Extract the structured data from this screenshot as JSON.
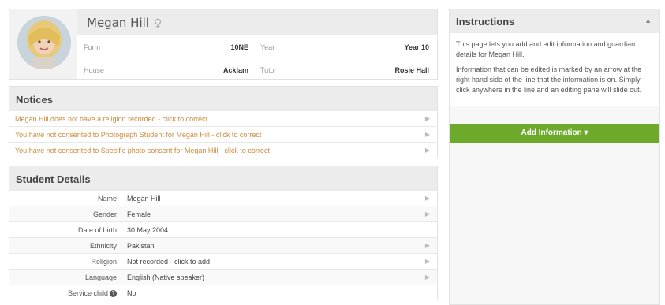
{
  "student": {
    "name": "Megan Hill",
    "gender_icon": "female-symbol-icon",
    "form_label": "Form",
    "form_value": "10NE",
    "year_label": "Year",
    "year_value": "Year 10",
    "house_label": "House",
    "house_value": "Acklam",
    "tutor_label": "Tutor",
    "tutor_value": "Rosie Hall"
  },
  "notices": {
    "title": "Notices",
    "items": [
      "Megan Hill does not have a religion recorded - click to correct",
      "You have not consented to Photograph Student for Megan Hill - click to correct",
      "You have not consented to Specific photo consent for Megan Hill - click to correct"
    ]
  },
  "details": {
    "title": "Student Details",
    "rows": [
      {
        "label": "Name",
        "value": "Megan Hill"
      },
      {
        "label": "Gender",
        "value": "Female"
      },
      {
        "label": "Date of birth",
        "value": "30 May 2004"
      },
      {
        "label": "Ethnicity",
        "value": "Pakistani"
      },
      {
        "label": "Religion",
        "value": "Not recorded - click to add"
      },
      {
        "label": "Language",
        "value": "English (Native speaker)"
      },
      {
        "label": "Service child",
        "value": "No"
      }
    ]
  },
  "instructions": {
    "title": "Instructions",
    "para1": "This page lets you add and edit information and guardian details for Megan Hill.",
    "para2": "Information that can be edited is marked by an arrow at the right hand side of the line that the information is on. Simply click anywhere in the line and an editing pane will slide out."
  },
  "add_info_label": "Add Information ▾",
  "colors": {
    "accent_green": "#6daa2c",
    "notice_orange": "#d0883a"
  }
}
